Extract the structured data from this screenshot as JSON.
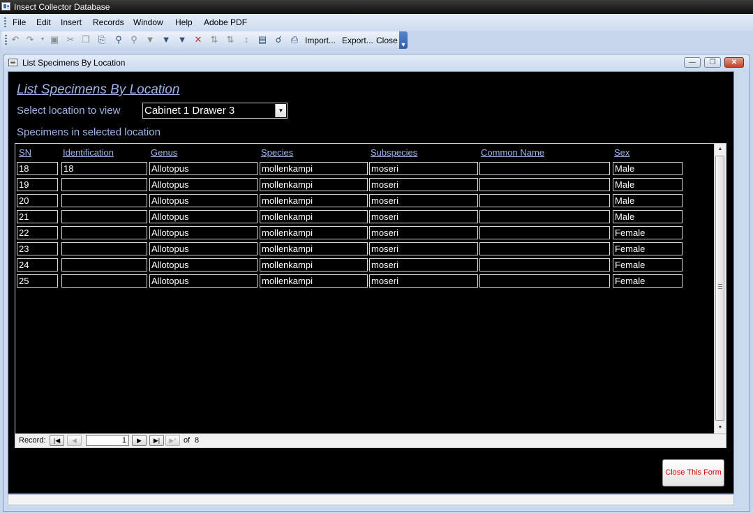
{
  "app": {
    "title": "Insect Collector Database"
  },
  "menu": {
    "items": [
      "File",
      "Edit",
      "Insert",
      "Records",
      "Window",
      "Help",
      "Adobe PDF"
    ]
  },
  "toolbar": {
    "import_label": "Import...",
    "export_label": "Export...",
    "close_label": "Close"
  },
  "form_window": {
    "title": "List Specimens By Location"
  },
  "form": {
    "heading": "List Specimens By Location",
    "location_label": "Select location to view",
    "location_value": "Cabinet 1 Drawer 3",
    "specimens_label": "Specimens in selected location",
    "close_button": "Close This Form"
  },
  "table": {
    "columns": [
      "SN",
      "Identification",
      "Genus",
      "Species",
      "Subspecies",
      "Common Name",
      "Sex"
    ],
    "rows": [
      [
        "18",
        "18",
        "Allotopus",
        "mollenkampi",
        "moseri",
        "",
        "Male"
      ],
      [
        "19",
        "",
        "Allotopus",
        "mollenkampi",
        "moseri",
        "",
        "Male"
      ],
      [
        "20",
        "",
        "Allotopus",
        "mollenkampi",
        "moseri",
        "",
        "Male"
      ],
      [
        "21",
        "",
        "Allotopus",
        "mollenkampi",
        "moseri",
        "",
        "Male"
      ],
      [
        "22",
        "",
        "Allotopus",
        "mollenkampi",
        "moseri",
        "",
        "Female"
      ],
      [
        "23",
        "",
        "Allotopus",
        "mollenkampi",
        "moseri",
        "",
        "Female"
      ],
      [
        "24",
        "",
        "Allotopus",
        "mollenkampi",
        "moseri",
        "",
        "Female"
      ],
      [
        "25",
        "",
        "Allotopus",
        "mollenkampi",
        "moseri",
        "",
        "Female"
      ]
    ]
  },
  "record_nav": {
    "label": "Record:",
    "current": "1",
    "of_label": "of",
    "total": "8"
  },
  "colors": {
    "form_background": "#000000",
    "label_text": "#9fb5ea",
    "close_button_text": "#e00000"
  }
}
